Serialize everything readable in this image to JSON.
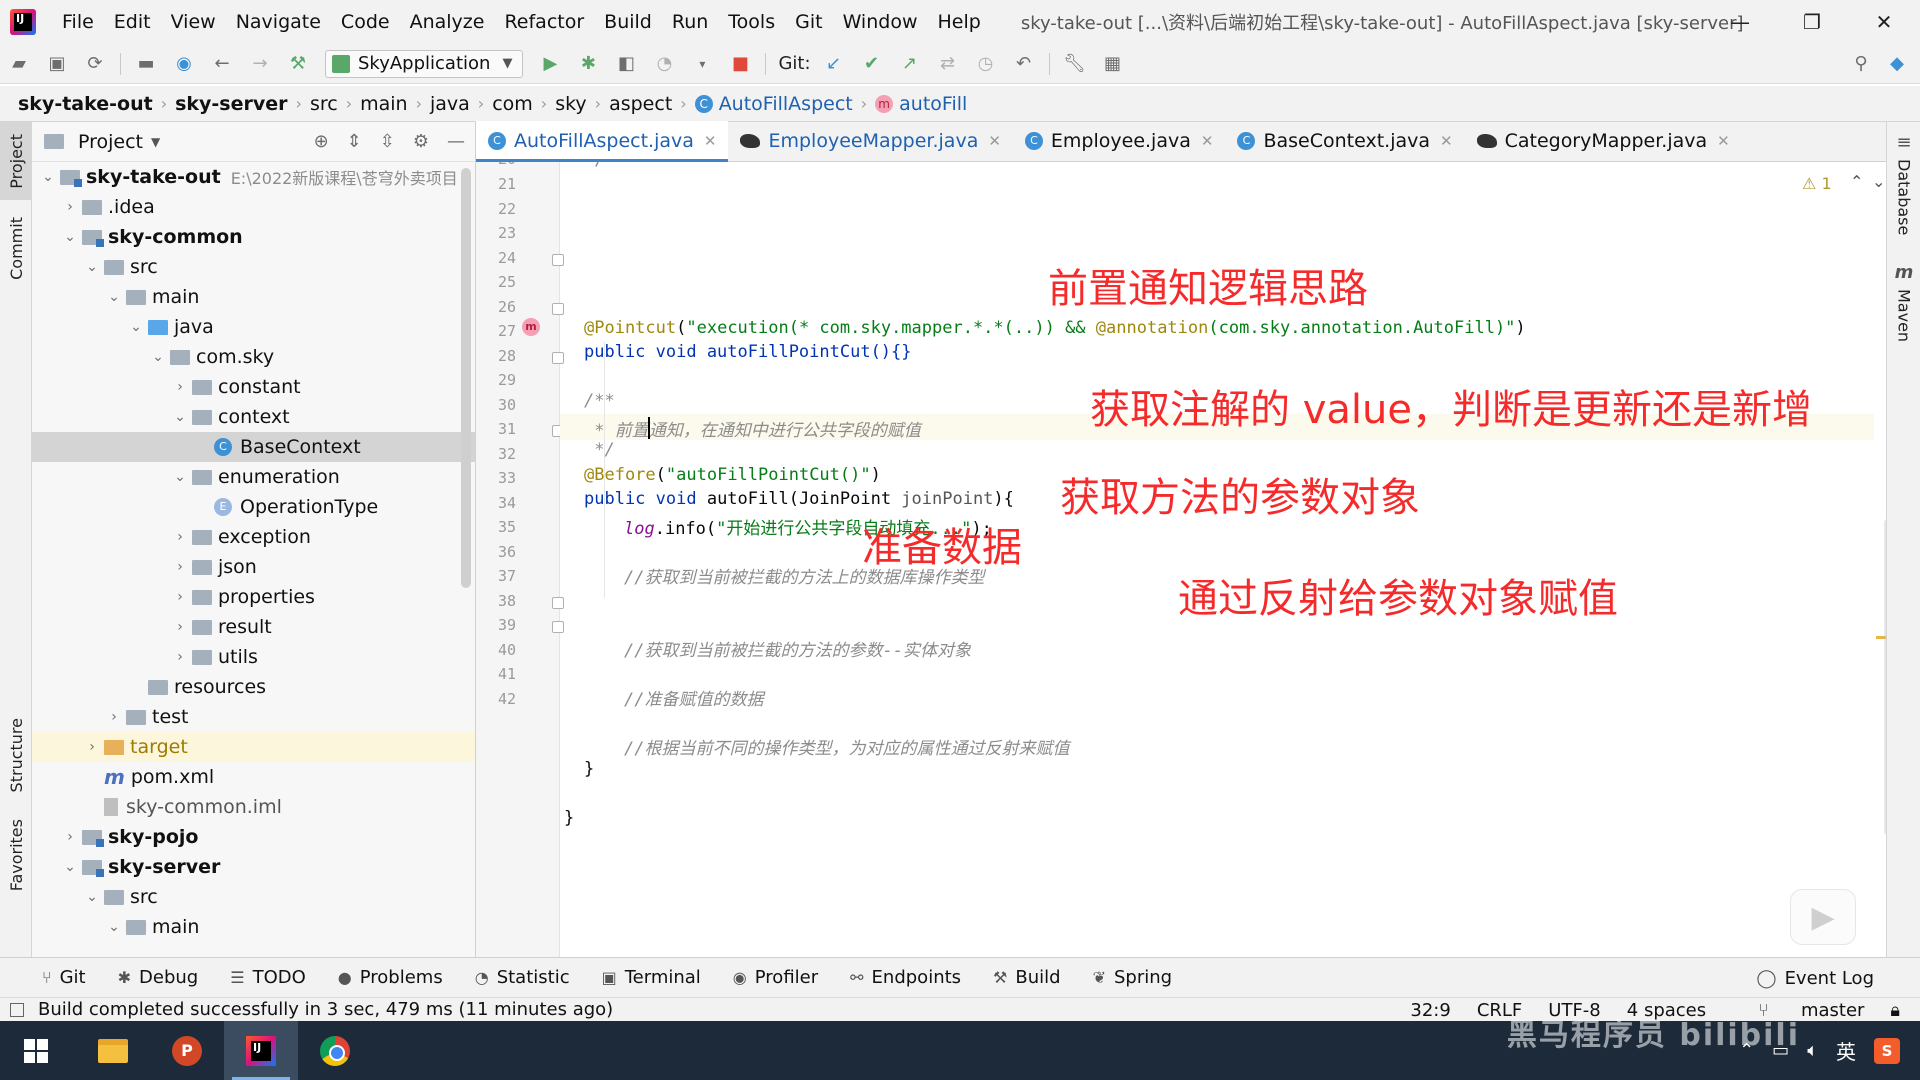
{
  "titlebar": {
    "menu": [
      "File",
      "Edit",
      "View",
      "Navigate",
      "Code",
      "Analyze",
      "Refactor",
      "Build",
      "Run",
      "Tools",
      "Git",
      "Window",
      "Help"
    ],
    "window_title": "sky-take-out [...\\资料\\后端初始工程\\sky-take-out] - AutoFillAspect.java [sky-server]",
    "controls": [
      "—",
      "❐",
      "✕"
    ]
  },
  "toolbar": {
    "run_config": "SkyApplication",
    "git_label": "Git:"
  },
  "breadcrumb": {
    "items": [
      "sky-take-out",
      "sky-server",
      "src",
      "main",
      "java",
      "com",
      "sky",
      "aspect",
      "AutoFillAspect",
      "autoFill"
    ]
  },
  "left_strip": [
    "Project",
    "Commit",
    "Structure",
    "Favorites"
  ],
  "project_panel": {
    "title": "Project",
    "tree": [
      {
        "label": "sky-take-out",
        "note": "E:\\2022新版课程\\苍穹外卖项目",
        "arrow": "⌄",
        "level": 0,
        "icon": "module-folder",
        "bold": true
      },
      {
        "label": ".idea",
        "arrow": "›",
        "level": 1,
        "icon": "folder"
      },
      {
        "label": "sky-common",
        "arrow": "⌄",
        "level": 1,
        "icon": "module-folder",
        "bold": true
      },
      {
        "label": "src",
        "arrow": "⌄",
        "level": 2,
        "icon": "folder"
      },
      {
        "label": "main",
        "arrow": "⌄",
        "level": 3,
        "icon": "folder"
      },
      {
        "label": "java",
        "arrow": "⌄",
        "level": 4,
        "icon": "source-folder"
      },
      {
        "label": "com.sky",
        "arrow": "⌄",
        "level": 5,
        "icon": "package"
      },
      {
        "label": "constant",
        "arrow": "›",
        "level": 6,
        "icon": "package"
      },
      {
        "label": "context",
        "arrow": "⌄",
        "level": 6,
        "icon": "package"
      },
      {
        "label": "BaseContext",
        "arrow": "",
        "level": 7,
        "icon": "class",
        "selected": true
      },
      {
        "label": "enumeration",
        "arrow": "⌄",
        "level": 6,
        "icon": "package"
      },
      {
        "label": "OperationType",
        "arrow": "",
        "level": 7,
        "icon": "enum"
      },
      {
        "label": "exception",
        "arrow": "›",
        "level": 6,
        "icon": "package"
      },
      {
        "label": "json",
        "arrow": "›",
        "level": 6,
        "icon": "package"
      },
      {
        "label": "properties",
        "arrow": "›",
        "level": 6,
        "icon": "package"
      },
      {
        "label": "result",
        "arrow": "›",
        "level": 6,
        "icon": "package"
      },
      {
        "label": "utils",
        "arrow": "›",
        "level": 6,
        "icon": "package"
      },
      {
        "label": "resources",
        "arrow": "",
        "level": 4,
        "icon": "resources-folder"
      },
      {
        "label": "test",
        "arrow": "›",
        "level": 3,
        "icon": "folder"
      },
      {
        "label": "target",
        "arrow": "›",
        "level": 2,
        "icon": "excluded-folder",
        "target": true
      },
      {
        "label": "pom.xml",
        "arrow": "",
        "level": 2,
        "icon": "maven-file"
      },
      {
        "label": "sky-common.iml",
        "arrow": "",
        "level": 2,
        "icon": "iml-file"
      },
      {
        "label": "sky-pojo",
        "arrow": "›",
        "level": 1,
        "icon": "module-folder",
        "bold": true
      },
      {
        "label": "sky-server",
        "arrow": "⌄",
        "level": 1,
        "icon": "module-folder",
        "bold": true
      },
      {
        "label": "src",
        "arrow": "⌄",
        "level": 2,
        "icon": "folder"
      },
      {
        "label": "main",
        "arrow": "⌄",
        "level": 3,
        "icon": "folder"
      }
    ]
  },
  "editor_tabs": [
    {
      "label": "AutoFillAspect.java",
      "icon": "class",
      "active": true
    },
    {
      "label": "EmployeeMapper.java",
      "icon": "mybatis-bird",
      "mapper": true
    },
    {
      "label": "Employee.java",
      "icon": "class"
    },
    {
      "label": "BaseContext.java",
      "icon": "class"
    },
    {
      "label": "CategoryMapper.java",
      "icon": "mybatis-bird"
    }
  ],
  "editor": {
    "line_numbers": [
      "21",
      "22",
      "23",
      "24",
      "25",
      "26",
      "27",
      "28",
      "29",
      "30",
      "31",
      "32",
      "33",
      "34",
      "35",
      "36",
      "37",
      "38",
      "39",
      "40",
      "41",
      "42"
    ],
    "line20_partial": "20",
    "code": {
      "l21_ann": "@Pointcut",
      "l21_str": "\"execution(* com.sky.mapper.*.*(..)) && ",
      "l21_ann2": "@annotation",
      "l21_str2": "(com.sky.annotation.AutoFill)\"",
      "l22": "public void autoFillPointCut(){}",
      "l24": "/**",
      "l25": " * 前置通知，在通知中进行公共字段的赋值",
      "l26": " */",
      "l27_ann": "@Before",
      "l27_str": "\"autoFillPointCut()\"",
      "l28_kw": "public void ",
      "l28_name": "autoFill(JoinPoint ",
      "l28_param": "joinPoint",
      "l28_end": "){",
      "l29_fld": "log",
      "l29_call": ".info(",
      "l29_str": "\"开始进行公共字段自动填充...\"",
      "l29_end": ");",
      "l31": "//获取到当前被拦截的方法上的数据库操作类型",
      "l34": "//获取到当前被拦截的方法的参数--实体对象",
      "l36": "//准备赋值的数据",
      "l38": "//根据当前不同的操作类型，为对应的属性通过反射来赋值",
      "l39": "}",
      "l41": "}"
    },
    "warning_count": "1",
    "method_marker": "m",
    "notes": {
      "n1": "前置通知逻辑思路",
      "n2": "获取注解的 value，判断是更新还是新增",
      "n3": "获取方法的参数对象",
      "n4": "准备数据",
      "n5": "通过反射给参数对象赋值"
    }
  },
  "right_strip": [
    "Database",
    "Maven"
  ],
  "tool_windows": [
    {
      "label": "Git",
      "icon": "git-branch-icon"
    },
    {
      "label": "Debug",
      "icon": "bug-icon"
    },
    {
      "label": "TODO",
      "icon": "list-icon"
    },
    {
      "label": "Problems",
      "icon": "info-icon"
    },
    {
      "label": "Statistic",
      "icon": "statistic-icon"
    },
    {
      "label": "Terminal",
      "icon": "terminal-icon"
    },
    {
      "label": "Profiler",
      "icon": "profiler-icon"
    },
    {
      "label": "Endpoints",
      "icon": "endpoints-icon"
    },
    {
      "label": "Build",
      "icon": "hammer-icon"
    },
    {
      "label": "Spring",
      "icon": "spring-icon"
    }
  ],
  "event_log": "Event Log",
  "status_bar": {
    "message": "Build completed successfully in 3 sec, 479 ms (11 minutes ago)",
    "position": "32:9",
    "line_sep": "CRLF",
    "encoding": "UTF-8",
    "indent": "4 spaces",
    "branch": "master"
  },
  "taskbar": {
    "apps": [
      "File Explorer",
      "PowerPoint",
      "IntelliJ IDEA",
      "Chrome"
    ],
    "ime": "英",
    "watermark": "黑马程序员 bilibili",
    "ppt_letter": "P",
    "ij_letters": "IJ"
  }
}
